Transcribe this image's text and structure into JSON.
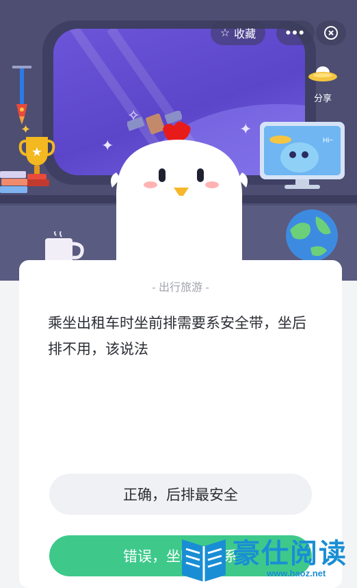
{
  "header": {
    "favorite_label": "收藏",
    "share_label": "分享",
    "monitor_text": "Hi~"
  },
  "card": {
    "category": "- 出行旅游 -",
    "question": "乘坐出租车时坐前排需要系安全带，坐后排不用，该说法",
    "options": [
      {
        "label": "正确，后排最安全"
      },
      {
        "label": "错误，坐哪都要系"
      }
    ]
  },
  "watermark": {
    "title": "豪仕阅读",
    "url": "www.haoz.net"
  },
  "colors": {
    "scene_bg": "#4d4e72",
    "window_glass": "#6c55d8",
    "card_bg": "#ffffff",
    "option_correct_bg": "#3ec98b",
    "option_neutral_bg": "#f0f1f4",
    "watermark": "#1a8ed4"
  }
}
